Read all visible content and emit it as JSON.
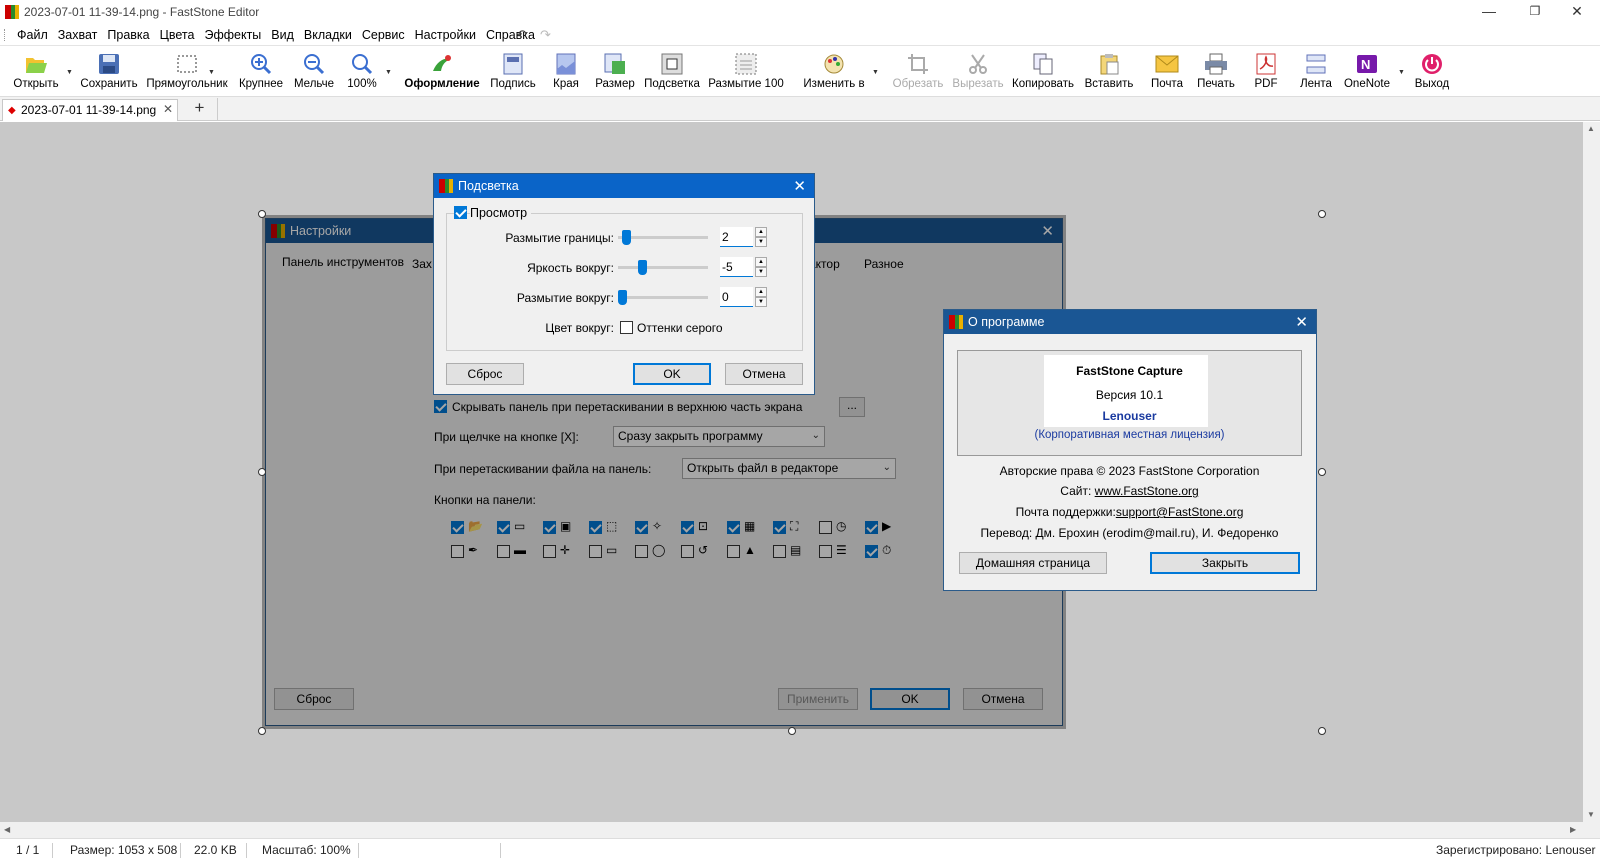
{
  "window": {
    "title": "2023-07-01 11-39-14.png - FastStone Editor"
  },
  "menu": [
    "Файл",
    "Захват",
    "Правка",
    "Цвета",
    "Эффекты",
    "Вид",
    "Вкладки",
    "Сервис",
    "Настройки",
    "Справка"
  ],
  "toolbar": {
    "open": "Открыть",
    "save": "Сохранить",
    "rect": "Прямоугольник",
    "zoom_in": "Крупнее",
    "zoom_out": "Мельче",
    "zoom_100": "100%",
    "decorate": "Оформление",
    "caption": "Подпись",
    "edges": "Края",
    "resize": "Размер",
    "spotlight": "Подсветка",
    "blur": "Размытие 100",
    "change": "Изменить в",
    "crop": "Обрезать",
    "cut": "Вырезать",
    "copy": "Копировать",
    "paste": "Вставить",
    "mail": "Почта",
    "print": "Печать",
    "pdf": "PDF",
    "tape": "Лента",
    "onenote": "OneNote",
    "exit": "Выход"
  },
  "tabs": {
    "active": "2023-07-01 11-39-14.png",
    "add": "+"
  },
  "status": {
    "page": "1 / 1",
    "size": "Размер: 1053 x 508",
    "filesize": "22.0 KB",
    "zoom": "Масштаб: 100%",
    "registered": "Зарегистрировано: Lenouser"
  },
  "settings_dialog": {
    "title": "Настройки",
    "tabs": [
      "Панель инструментов",
      "Зах",
      "дактор",
      "Разное"
    ],
    "hide_panel": "Скрывать панель при перетаскивании в верхнюю часть экрана",
    "dots": "...",
    "on_close_label": "При щелчке на кнопке [X]:",
    "on_close_value": "Сразу закрыть программу",
    "on_drag_label": "При перетаскивании файла на панель:",
    "on_drag_value": "Открыть файл в редакторе",
    "buttons_label": "Кнопки на панели:",
    "row1_checked": [
      true,
      true,
      true,
      true,
      true,
      true,
      true,
      true,
      false,
      true
    ],
    "row2_checked": [
      false,
      false,
      false,
      false,
      false,
      false,
      false,
      false,
      false,
      true
    ],
    "reset": "Сброс",
    "apply": "Применить",
    "ok": "OK",
    "cancel": "Отмена"
  },
  "spotlight_dialog": {
    "title": "Подсветка",
    "preview": "Просмотр",
    "edge_blur_label": "Размытие границы:",
    "edge_blur_value": "2",
    "edge_blur_level": 0.05,
    "brightness_label": "Яркость вокруг:",
    "brightness_value": "-5",
    "brightness_level": 0.25,
    "blur_around_label": "Размытие вокруг:",
    "blur_around_value": "0",
    "blur_around_level": 0.0,
    "color_label": "Цвет вокруг:",
    "grayscale": "Оттенки серого",
    "reset": "Сброс",
    "ok": "OK",
    "cancel": "Отмена"
  },
  "about_dialog": {
    "title": "О программе",
    "product": "FastStone Capture",
    "version": "Версия 10.1",
    "user": "Lenouser",
    "license": "(Корпоративная местная лицензия)",
    "copyright": "Авторские права © 2023 FastStone Corporation",
    "site_label": "Сайт:",
    "site": "www.FastStone.org",
    "mail_label": "Почта поддержки:",
    "mail": "support@FastStone.org",
    "translation": "Перевод: Дм. Ерохин (erodim@mail.ru), И. Федоренко",
    "home": "Домашняя страница",
    "close": "Закрыть"
  },
  "colors": {
    "accent": "#0078d7",
    "title_blue": "#1a5694",
    "canvas": "#c8c8c8"
  }
}
